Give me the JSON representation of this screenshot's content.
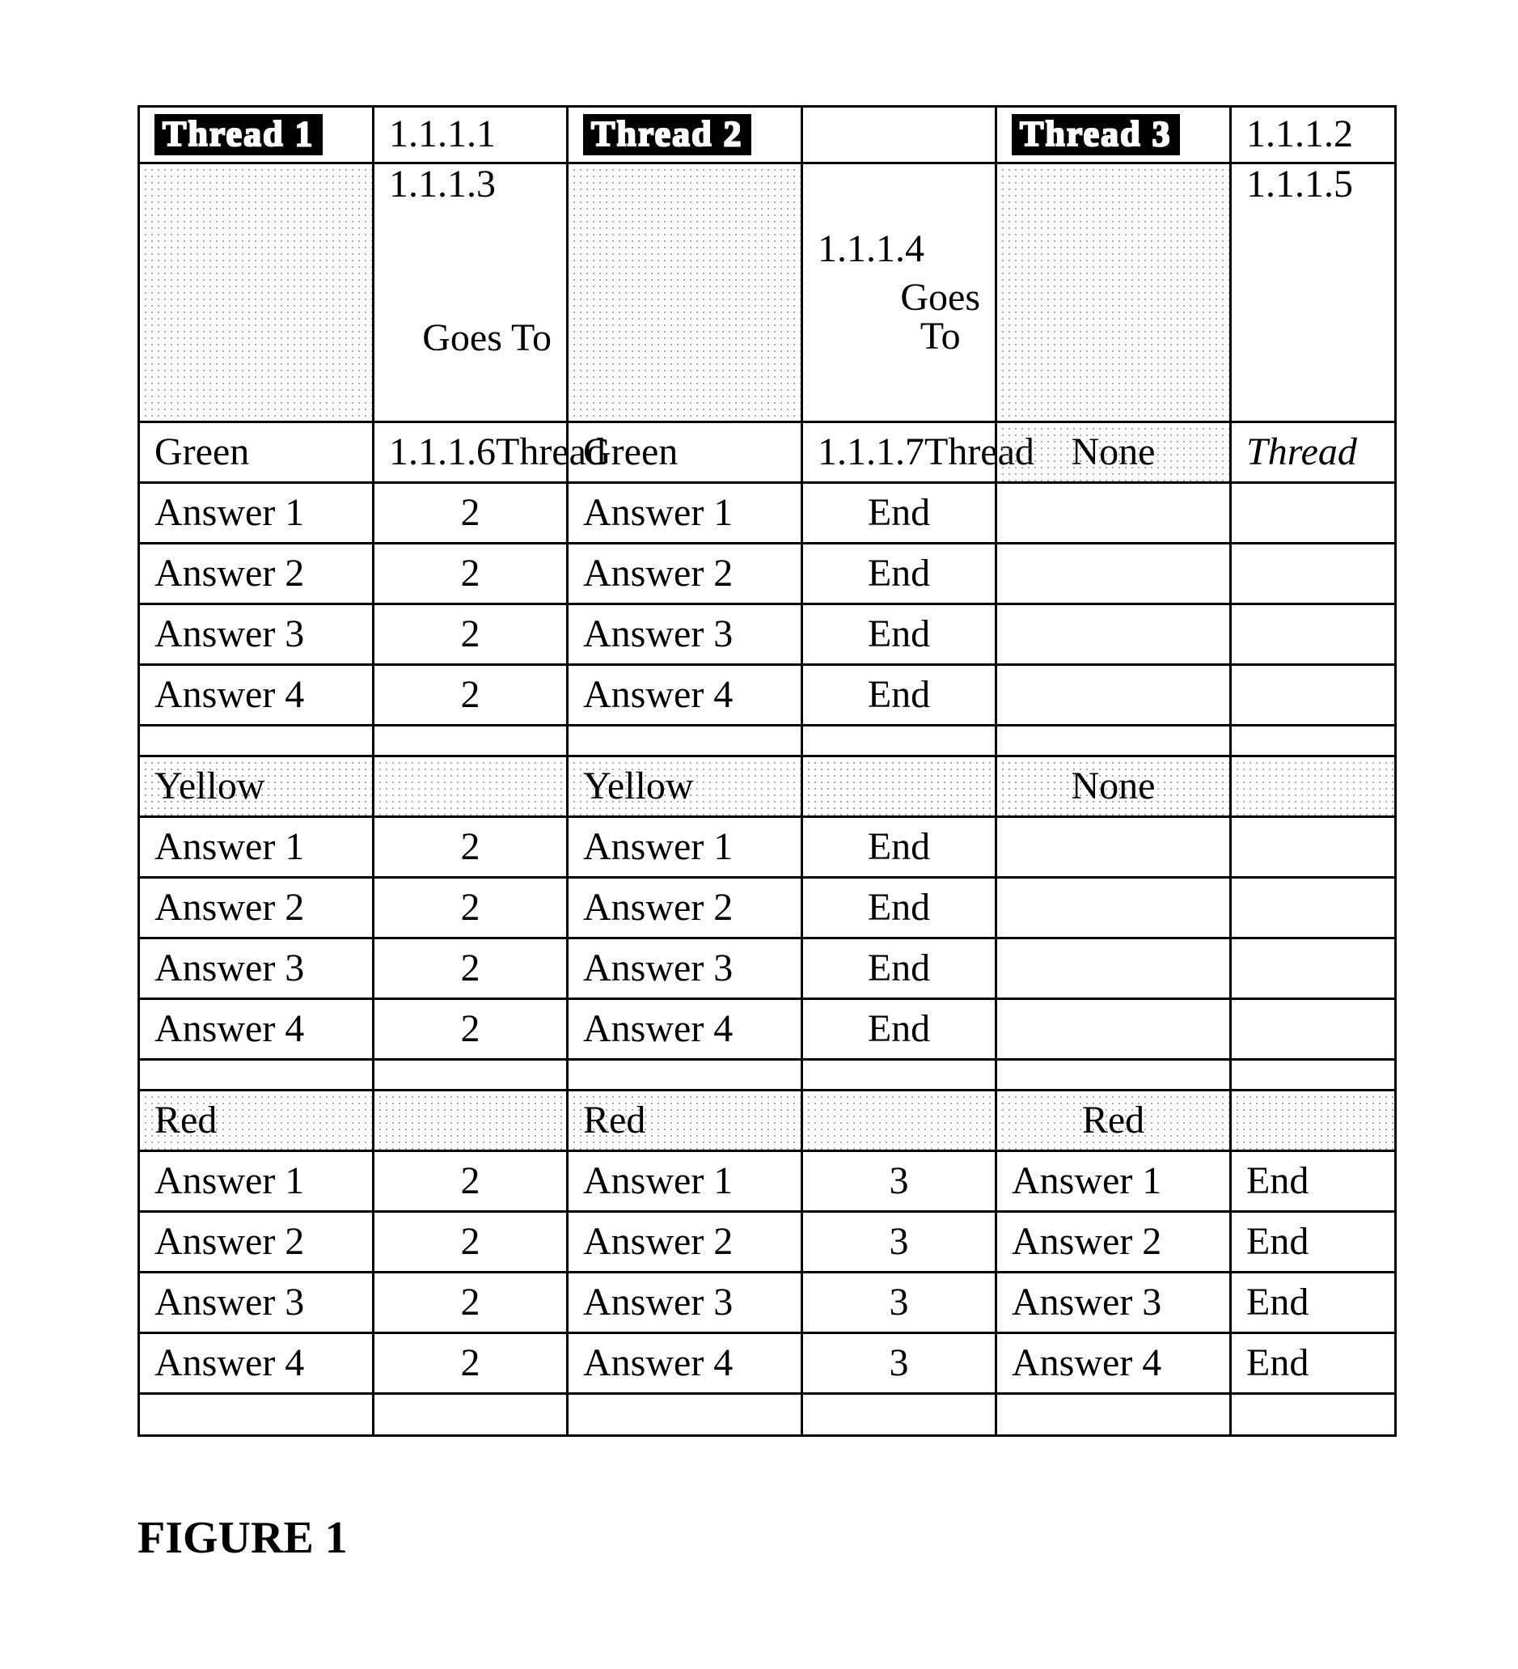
{
  "figure_label": "FIGURE 1",
  "headers": {
    "thread1": "Thread 1",
    "thread2": "Thread 2",
    "thread3": "Thread 3",
    "goes_to": "Goes To",
    "goes_to_stack": "Goes\nTo",
    "ref_col1_line1": "1.1.1.1",
    "ref_col1_line2": "1.1.1.3",
    "ref_col2": "1.1.1.4",
    "ref_col3_line1": "1.1.1.2",
    "ref_col3_line2": "1.1.1.5",
    "thread_word": "Thread"
  },
  "sections": [
    {
      "t1_status": "Green",
      "t1_extra": "1.1.1.6",
      "t2_status": "Green",
      "t2_extra": "1.1.1.7",
      "t3_status": "None",
      "rows": [
        {
          "t1": "Answer 1",
          "t1to": "2",
          "t2": "Answer 1",
          "t2to": "End",
          "t3": "",
          "t3to": ""
        },
        {
          "t1": "Answer 2",
          "t1to": "2",
          "t2": "Answer 2",
          "t2to": "End",
          "t3": "",
          "t3to": ""
        },
        {
          "t1": "Answer 3",
          "t1to": "2",
          "t2": "Answer 3",
          "t2to": "End",
          "t3": "",
          "t3to": ""
        },
        {
          "t1": "Answer 4",
          "t1to": "2",
          "t2": "Answer 4",
          "t2to": "End",
          "t3": "",
          "t3to": ""
        }
      ]
    },
    {
      "t1_status": "Yellow",
      "t1_extra": "",
      "t2_status": "Yellow",
      "t2_extra": "",
      "t3_status": "None",
      "rows": [
        {
          "t1": "Answer 1",
          "t1to": "2",
          "t2": "Answer 1",
          "t2to": "End",
          "t3": "",
          "t3to": ""
        },
        {
          "t1": "Answer 2",
          "t1to": "2",
          "t2": "Answer 2",
          "t2to": "End",
          "t3": "",
          "t3to": ""
        },
        {
          "t1": "Answer 3",
          "t1to": "2",
          "t2": "Answer 3",
          "t2to": "End",
          "t3": "",
          "t3to": ""
        },
        {
          "t1": "Answer 4",
          "t1to": "2",
          "t2": "Answer 4",
          "t2to": "End",
          "t3": "",
          "t3to": ""
        }
      ]
    },
    {
      "t1_status": "Red",
      "t1_extra": "",
      "t2_status": "Red",
      "t2_extra": "",
      "t3_status": "Red",
      "rows": [
        {
          "t1": "Answer 1",
          "t1to": "2",
          "t2": "Answer 1",
          "t2to": "3",
          "t3": "Answer 1",
          "t3to": "End"
        },
        {
          "t1": "Answer 2",
          "t1to": "2",
          "t2": "Answer 2",
          "t2to": "3",
          "t3": "Answer 2",
          "t3to": "End"
        },
        {
          "t1": "Answer 3",
          "t1to": "2",
          "t2": "Answer 3",
          "t2to": "3",
          "t3": "Answer 3",
          "t3to": "End"
        },
        {
          "t1": "Answer 4",
          "t1to": "2",
          "t2": "Answer 4",
          "t2to": "3",
          "t3": "Answer 4",
          "t3to": "End"
        }
      ]
    }
  ]
}
